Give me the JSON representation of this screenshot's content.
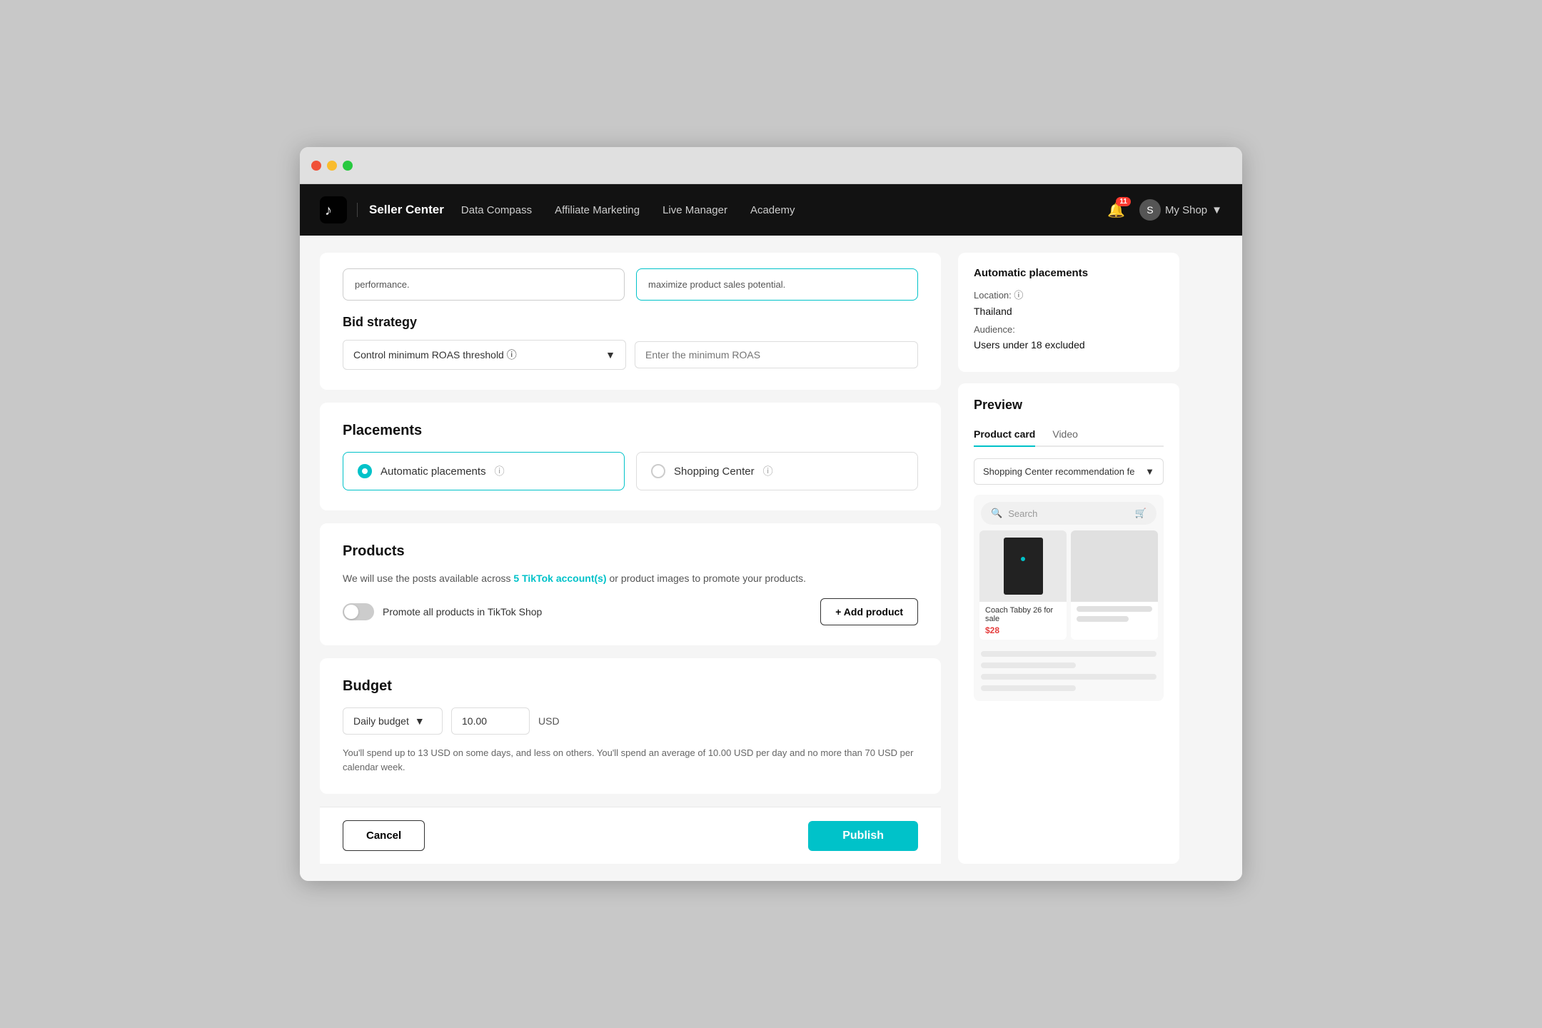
{
  "browser": {
    "dots": [
      "red",
      "yellow",
      "green"
    ]
  },
  "navbar": {
    "brand": "Seller Center",
    "links": [
      "Data Compass",
      "Affiliate Marketing",
      "Live Manager",
      "Academy"
    ],
    "notification_count": "11",
    "my_shop": "My Shop"
  },
  "bid_strategy": {
    "section_label": "Bid strategy",
    "partial_options": [
      "performance.",
      "maximize product sales potential."
    ],
    "select_label": "Control minimum ROAS threshold ⓘ",
    "input_placeholder": "Enter the minimum ROAS"
  },
  "placements": {
    "section_label": "Placements",
    "options": [
      {
        "id": "auto",
        "label": "Automatic placements",
        "selected": true
      },
      {
        "id": "shopping",
        "label": "Shopping Center",
        "selected": false
      }
    ]
  },
  "products": {
    "section_label": "Products",
    "subtitle_before": "We will use the posts available across ",
    "link_text": "5 TikTok account(s)",
    "subtitle_after": " or product images to promote your products.",
    "toggle_label": "Promote all products in TikTok Shop",
    "add_product_label": "+ Add product"
  },
  "budget": {
    "section_label": "Budget",
    "select_label": "Daily budget",
    "amount": "10.00",
    "currency": "USD",
    "note": "You'll spend up to 13 USD on some days, and less on others. You'll spend an average of 10.00 USD per day and no more than 70 USD per calendar week."
  },
  "bottom_bar": {
    "cancel_label": "Cancel",
    "publish_label": "Publish"
  },
  "right_panel": {
    "auto_placements": {
      "title": "Automatic placements",
      "location_label": "Location: ⓘ",
      "location_value": "Thailand",
      "audience_label": "Audience:",
      "audience_value": "Users under 18 excluded"
    },
    "preview": {
      "title": "Preview",
      "tabs": [
        "Product card",
        "Video"
      ],
      "active_tab": "Product card",
      "dropdown_label": "Shopping Center recommendation fe",
      "search_placeholder": "Search",
      "product_name": "Coach Tabby 26 for sale",
      "product_price": "$28"
    }
  }
}
